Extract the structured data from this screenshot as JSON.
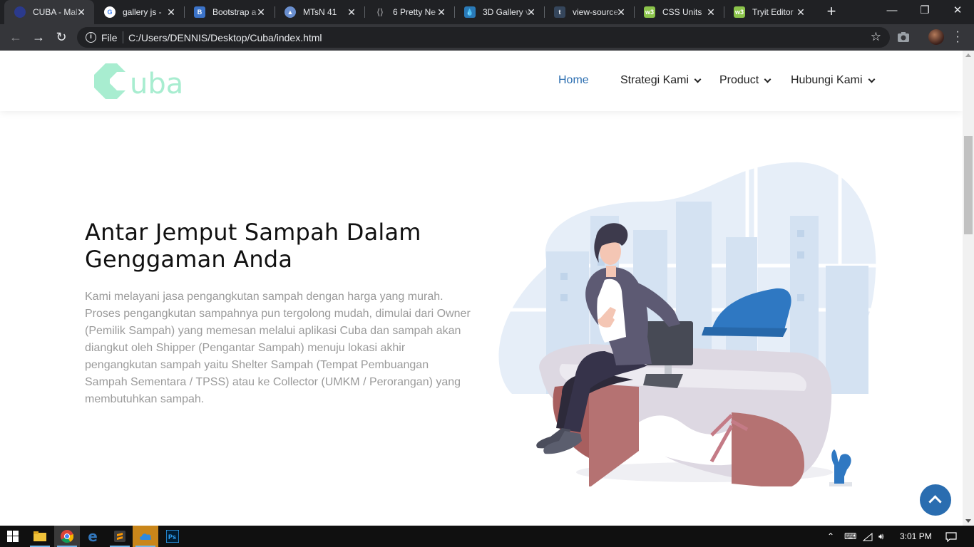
{
  "browser": {
    "tabs": [
      {
        "label": "CUBA - Mal",
        "icon": "cuba-favicon",
        "color": "#2b3a8c"
      },
      {
        "label": "gallery js - ",
        "icon": "google-icon",
        "color": "#ffffff"
      },
      {
        "label": "Bootstrap a",
        "icon": "bootstrap-icon",
        "color": "#3b73c9"
      },
      {
        "label": "MTsN 41",
        "icon": "mtsn-icon",
        "color": "#6a8fcf"
      },
      {
        "label": "6 Pretty Ne",
        "icon": "codepen-icon",
        "color": "#555555"
      },
      {
        "label": "3D Gallery v",
        "icon": "drop-icon",
        "color": "#2a7ab8"
      },
      {
        "label": "view-source",
        "icon": "tumblr-icon",
        "color": "#35465c"
      },
      {
        "label": "CSS Units",
        "icon": "w3schools-icon",
        "color": "#8bc34a"
      },
      {
        "label": "Tryit Editor",
        "icon": "w3schools-icon",
        "color": "#8bc34a"
      }
    ],
    "address": {
      "scheme_label": "File",
      "url": "C:/Users/DENNIS/Desktop/Cuba/index.html"
    }
  },
  "site": {
    "logo_text": "uba",
    "brand_color": "#a8edd0",
    "accent_color": "#2a6db0",
    "nav": [
      {
        "label": "Home",
        "active": true,
        "dropdown": false
      },
      {
        "label": "Strategi Kami",
        "active": false,
        "dropdown": true
      },
      {
        "label": "Product",
        "active": false,
        "dropdown": true
      },
      {
        "label": "Hubungi Kami",
        "active": false,
        "dropdown": true
      }
    ],
    "hero": {
      "title": "Antar Jemput Sampah Dalam Genggaman Anda",
      "text": "Kami melayani jasa pengangkutan sampah dengan harga yang murah. Proses pengangkutan sampahnya pun tergolong mudah, dimulai dari Owner (Pemilik Sampah) yang memesan melalui aplikasi Cuba dan sampah akan diangkut oleh Shipper (Pengantar Sampah) menuju lokasi akhir pengangkutan sampah yaitu Shelter Sampah (Tempat Pembuangan Sampah Sementara / TPSS) atau ke Collector (UMKM / Perorangan) yang membutuhkan sampah."
    }
  },
  "taskbar": {
    "time": "3:01 PM"
  }
}
